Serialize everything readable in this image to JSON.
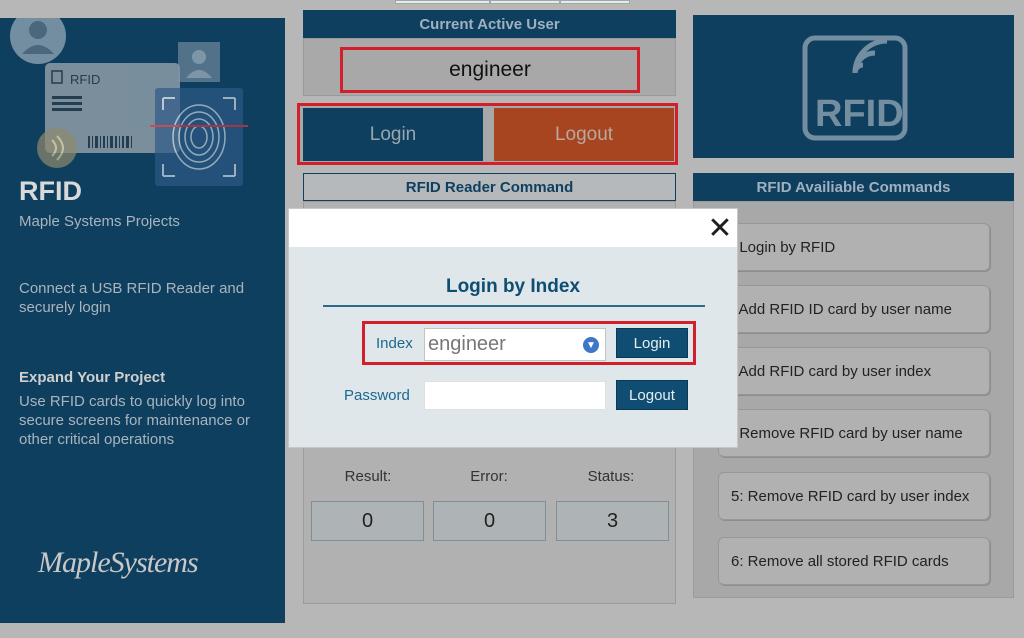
{
  "brand": {
    "title": "RFID",
    "subtitle": "Maple Systems Projects",
    "connect_text": "Connect a USB RFID Reader and securely login",
    "expand_title": "Expand Your Project",
    "expand_text": "Use RFID cards to quickly log into secure screens for maintenance or other critical operations",
    "logo_text": "MapleSystems",
    "card_label": "RFID"
  },
  "user_section": {
    "header": "Current Active User",
    "current_user": "engineer",
    "login_label": "Login",
    "logout_label": "Logout"
  },
  "reader_section": {
    "header": "RFID Reader Command",
    "result_label": "Result:",
    "error_label": "Error:",
    "status_label": "Status:",
    "result_value": "0",
    "error_value": "0",
    "status_value": "3"
  },
  "commands_section": {
    "logo_text": "RFID",
    "header": "RFID Availiable Commands",
    "items": [
      ": Login by RFID",
      ": Add RFID ID card by user name",
      ": Add RFID card by user index",
      ": Remove RFID card by user name",
      "5: Remove RFID card by user index",
      "6: Remove all stored RFID cards"
    ]
  },
  "modal": {
    "title": "Login by Index",
    "close_glyph": "✕",
    "index_label": "Index",
    "index_value": "engineer",
    "password_label": "Password",
    "password_value": "",
    "login_label": "Login",
    "logout_label": "Logout"
  },
  "colors": {
    "panel_navy": "#0f3f5f",
    "logout_orange": "#a64520",
    "highlight_red": "#d21f2c",
    "modal_accent": "#0f4e72"
  }
}
